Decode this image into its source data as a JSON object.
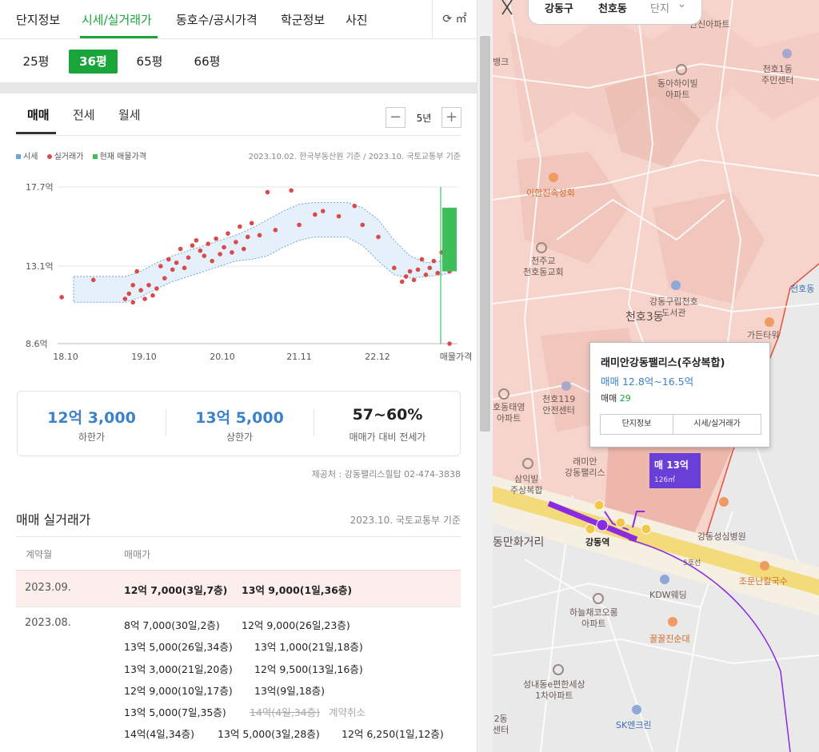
{
  "tabs": [
    "단지정보",
    "시세/실거래가",
    "동호수/공시가격",
    "학군정보",
    "사진"
  ],
  "refresh_label": "⟳ ㎡",
  "sizes": [
    "25평",
    "36평",
    "65평",
    "66평"
  ],
  "trade_tabs": [
    "매매",
    "전세",
    "월세"
  ],
  "period": {
    "minus": "−",
    "value": "5년",
    "plus": "+"
  },
  "legend": {
    "market": "시세",
    "actual": "실거래가",
    "current": "현재 매물가격"
  },
  "source_note": "2023.10.02. 한국부동산원 기준 / 2023.10. 국토교통부 기준",
  "chart_data": {
    "type": "scatter",
    "y_tick_labels": [
      "17.7억",
      "13.1억",
      "8.6억"
    ],
    "yticks": [
      17.7,
      13.1,
      8.6
    ],
    "ylim": [
      8.6,
      17.7
    ],
    "x_tick_labels": [
      "18.10",
      "19.10",
      "20.10",
      "21.11",
      "22.12",
      "매물가격"
    ],
    "grid": true,
    "market_band": {
      "x": [
        2018.75,
        2019.0,
        2019.4,
        2019.6,
        2019.8,
        2020.0,
        2020.2,
        2020.4,
        2020.6,
        2020.8,
        2021.0,
        2021.2,
        2021.4,
        2021.6,
        2021.8,
        2022.0,
        2022.2,
        2022.4,
        2022.6,
        2022.8,
        2023.0,
        2023.2,
        2023.4,
        2023.5
      ],
      "upper": [
        12.5,
        12.5,
        12.5,
        12.8,
        13.3,
        13.7,
        14.0,
        14.3,
        14.6,
        14.9,
        15.3,
        15.8,
        16.3,
        16.7,
        16.8,
        16.8,
        16.8,
        16.5,
        15.8,
        14.6,
        13.7,
        13.3,
        13.4,
        13.5
      ],
      "lower": [
        11.0,
        11.0,
        11.0,
        11.3,
        11.8,
        12.2,
        12.5,
        12.8,
        13.1,
        13.4,
        13.5,
        13.7,
        14.2,
        14.6,
        14.8,
        14.8,
        14.8,
        14.3,
        13.4,
        12.6,
        12.4,
        12.5,
        12.6,
        12.7
      ],
      "color": "#6aa6dc"
    },
    "actual_points": [
      [
        2018.6,
        11.3
      ],
      [
        2019.0,
        12.3
      ],
      [
        2019.4,
        11.2
      ],
      [
        2019.45,
        11.5
      ],
      [
        2019.5,
        12.0
      ],
      [
        2019.5,
        11.0
      ],
      [
        2019.55,
        12.8
      ],
      [
        2019.6,
        11.7
      ],
      [
        2019.65,
        11.2
      ],
      [
        2019.7,
        12.0
      ],
      [
        2019.75,
        11.4
      ],
      [
        2019.8,
        11.8
      ],
      [
        2019.85,
        13.1
      ],
      [
        2019.9,
        12.4
      ],
      [
        2019.95,
        13.5
      ],
      [
        2020.0,
        12.9
      ],
      [
        2020.05,
        13.3
      ],
      [
        2020.1,
        14.1
      ],
      [
        2020.15,
        13.0
      ],
      [
        2020.2,
        13.6
      ],
      [
        2020.25,
        14.3
      ],
      [
        2020.3,
        14.6
      ],
      [
        2020.35,
        14.0
      ],
      [
        2020.4,
        13.7
      ],
      [
        2020.45,
        14.4
      ],
      [
        2020.5,
        13.4
      ],
      [
        2020.55,
        14.7
      ],
      [
        2020.6,
        13.8
      ],
      [
        2020.65,
        14.2
      ],
      [
        2020.7,
        15.0
      ],
      [
        2020.75,
        13.9
      ],
      [
        2020.8,
        14.5
      ],
      [
        2020.85,
        15.4
      ],
      [
        2020.9,
        14.1
      ],
      [
        2020.95,
        14.8
      ],
      [
        2021.0,
        15.6
      ],
      [
        2021.1,
        14.9
      ],
      [
        2021.2,
        17.4
      ],
      [
        2021.3,
        15.2
      ],
      [
        2021.5,
        17.5
      ],
      [
        2021.6,
        15.5
      ],
      [
        2021.8,
        16.1
      ],
      [
        2021.9,
        16.3
      ],
      [
        2022.1,
        16.0
      ],
      [
        2022.3,
        16.6
      ],
      [
        2022.4,
        15.5
      ],
      [
        2022.6,
        14.8
      ],
      [
        2022.8,
        13.0
      ],
      [
        2022.9,
        12.2
      ],
      [
        2022.95,
        12.5
      ],
      [
        2023.0,
        12.8
      ],
      [
        2023.05,
        12.3
      ],
      [
        2023.1,
        12.9
      ],
      [
        2023.15,
        13.5
      ],
      [
        2023.2,
        12.6
      ],
      [
        2023.25,
        13.0
      ],
      [
        2023.3,
        13.4
      ],
      [
        2023.35,
        12.7
      ],
      [
        2023.4,
        13.9
      ],
      [
        2023.45,
        13.1
      ],
      [
        2023.5,
        12.8
      ],
      [
        2023.5,
        8.6
      ]
    ],
    "current_listing": {
      "low": 12.8,
      "high": 16.5,
      "color": "#3fbf5a"
    },
    "actual_color": "#d94a4a"
  },
  "summary": [
    {
      "value": "12억 3,000",
      "label": "하한가"
    },
    {
      "value": "13억 5,000",
      "label": "상한가"
    },
    {
      "value": "57~60%",
      "label": "매매가 대비 전세가"
    }
  ],
  "provider": "제공처 : 강동팰리스힐탑 02-474-3838",
  "deals_title": "매매 실거래가",
  "deals_basis": "2023.10. 국토교통부 기준",
  "deals_header": {
    "month": "계약월",
    "price": "매매가"
  },
  "deals": {
    "sep": {
      "date": "2023.09.",
      "items": [
        "12억 7,000(3일,7층)",
        "13억 9,000(1일,36층)"
      ]
    },
    "aug": {
      "date": "2023.08.",
      "rows": [
        [
          "8억 7,000(30일,2층)",
          "12억 9,000(26일,23층)"
        ],
        [
          "13억 5,000(26일,34층)",
          "13억 1,000(21일,18층)"
        ],
        [
          "13억 3,000(21일,20층)",
          "12억 9,500(13일,16층)"
        ],
        [
          "12억 9,000(10일,17층)",
          "13억(9일,18층)"
        ],
        [
          "13억 5,000(7일,35층)"
        ],
        [
          "14억(4일,34층)",
          "13억 5,000(3일,28층)",
          "12억 6,250(1일,12층)"
        ]
      ],
      "cancelled": "14억(4일,34층)",
      "cancel_note": "계약취소"
    }
  },
  "map": {
    "search_bar": [
      "강동구",
      "천호동",
      "단지"
    ],
    "labels": {
      "hanshin": "한신아파트",
      "bank": "뱅크",
      "donga": "동아하이빌\n아파트",
      "cheonho1": "천호1동\n주민센터",
      "ihan": "이한진속성회",
      "cheonju": "천주교\n천호동교회",
      "library": "강동구립천호\n도서관",
      "cheonho3": "천호3동",
      "gaden": "가든타워",
      "cheonhodong": "천호동",
      "taeyoung": "호동태영\n아파트",
      "safety": "천호119\n안전센터",
      "raemian": "래미안\n강동팰리스",
      "samik": "삼익빌\n주상복합",
      "manhwa": "동만화거리",
      "gangdong_station": "강동역",
      "hospital": "강동성심병원",
      "kdw": "KDW웨딩",
      "noodle": "조문난칼국수",
      "haneul": "하늘채코오롱\n아파트",
      "ggul": "꿀꿀진순대",
      "seongnae": "성내동e편한세상\n1차아파트",
      "sk": "SK엔크린",
      "line5": "5호선",
      "center": "2동\n센터"
    },
    "popup": {
      "title": "래미안강동팰리스(주상복합)",
      "range": "매매 12.8억~16.5억",
      "count_label": "매매",
      "count": "29",
      "btn_info": "단지정보",
      "btn_price": "시세/실거래가"
    },
    "marker": {
      "price": "매 13억",
      "area": "126㎡"
    }
  }
}
